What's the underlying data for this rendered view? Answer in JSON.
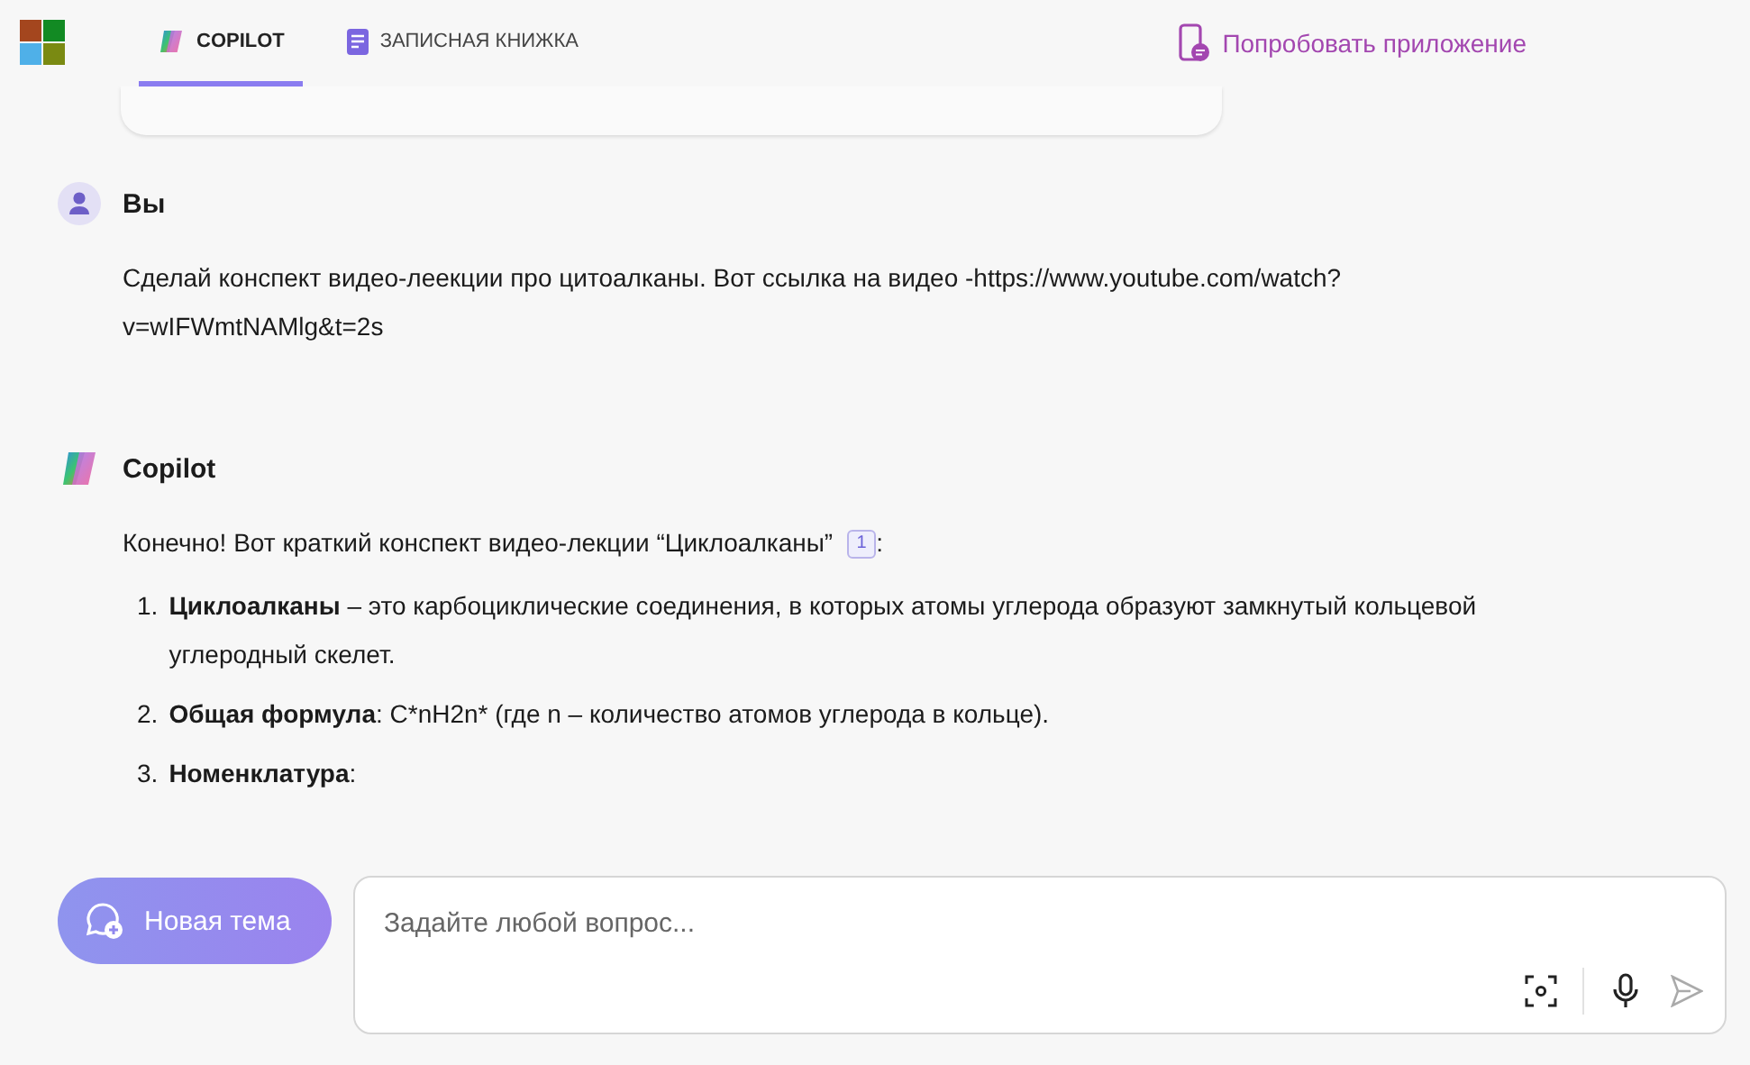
{
  "header": {
    "tabs": [
      {
        "label": "COPILOT",
        "selected": true
      },
      {
        "label": "ЗАПИСНАЯ КНИЖКА",
        "selected": false
      }
    ],
    "app_link": "Попробовать приложение"
  },
  "messages": [
    {
      "kind": "user",
      "author": "Вы",
      "text": "Сделай конспект видео-леекции про цитоалканы. Вот ссылка на видео -https://www.youtube.com/watch?v=wIFWmtNAMlg&t=2s"
    },
    {
      "kind": "bot",
      "author": "Copilot",
      "intro": "Конечно! Вот краткий конспект видео-лекции “Циклоалканы”",
      "footnote": "1",
      "intro_end": ":",
      "items": [
        {
          "number": "1.",
          "term": "Циклоалканы",
          "text": " – это карбоциклические соединения, в которых атомы углерода образуют замкнутый кольцевой углеродный скелет."
        },
        {
          "number": "2.",
          "term": "Общая формула",
          "text": ": C*nH2n* (где n – количество атомов углерода в кольце)."
        },
        {
          "number": "3.",
          "term": "Номенклатура",
          "text": ":"
        }
      ]
    }
  ],
  "composer": {
    "new_topic": "Новая тема",
    "placeholder": "Задайте любой вопрос..."
  }
}
